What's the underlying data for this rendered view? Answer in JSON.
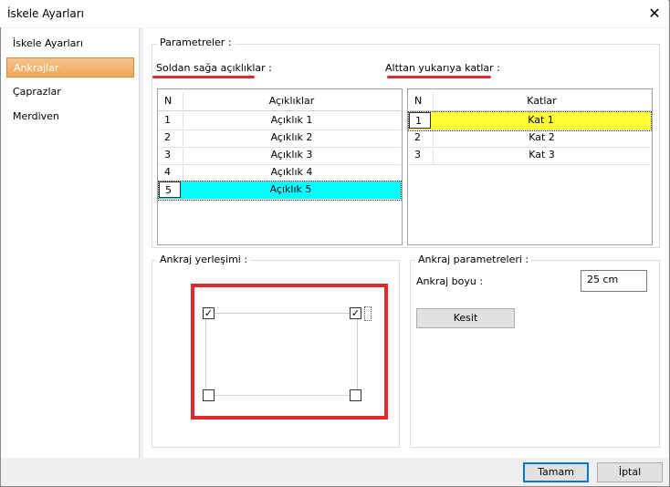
{
  "window": {
    "title": "İskele Ayarları"
  },
  "sidebar": {
    "items": [
      {
        "label": "İskele Ayarları"
      },
      {
        "label": "Ankrajlar"
      },
      {
        "label": "Çaprazlar"
      },
      {
        "label": "Merdiven"
      }
    ]
  },
  "params": {
    "group_label": "Parametreler :",
    "spans_label": "Soldan sağa açıklıklar :",
    "floors_label": "Alttan yukarıya katlar :",
    "spans_table": {
      "col_n": "N",
      "col_name": "Açıklıklar",
      "rows": [
        {
          "n": "1",
          "name": "Açıklık 1"
        },
        {
          "n": "2",
          "name": "Açıklık 2"
        },
        {
          "n": "3",
          "name": "Açıklık 3"
        },
        {
          "n": "4",
          "name": "Açıklık 4"
        },
        {
          "n": "5",
          "name": "Açıklık 5"
        }
      ]
    },
    "floors_table": {
      "col_n": "N",
      "col_name": "Katlar",
      "rows": [
        {
          "n": "1",
          "name": "Kat 1"
        },
        {
          "n": "2",
          "name": "Kat 2"
        },
        {
          "n": "3",
          "name": "Kat 3"
        }
      ]
    }
  },
  "placement": {
    "label": "Ankraj yerleşimi :",
    "checks": {
      "top_left": "✓",
      "top_right": "✓",
      "bottom_left": "",
      "bottom_right": ""
    }
  },
  "anchor_params": {
    "label": "Ankraj parametreleri :",
    "length_label": "Ankraj boyu :",
    "length_value": "25 cm",
    "section_button": "Kesit"
  },
  "footer": {
    "ok": "Tamam",
    "cancel": "İptal"
  },
  "colors": {
    "highlight_red": "#e32a2a",
    "sel_cyan": "#00ffff",
    "sel_yellow": "#ffff33"
  }
}
